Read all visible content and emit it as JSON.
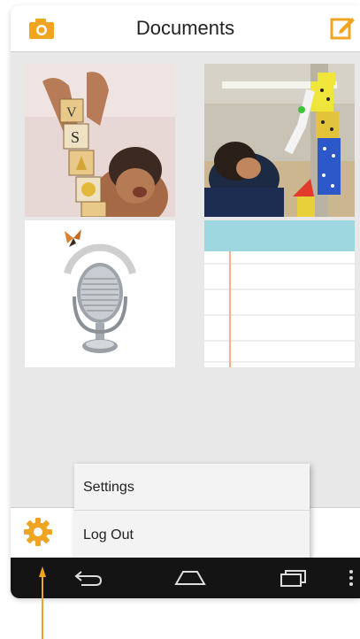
{
  "header": {
    "title": "Documents",
    "camera_icon": "camera-icon",
    "edit_icon": "compose-icon"
  },
  "documents": [
    {
      "thumb": "photo-child-blocks"
    },
    {
      "thumb": "photo-child-stacking-blocks"
    },
    {
      "thumb": "audio-microphone"
    },
    {
      "thumb": "notebook-paper"
    }
  ],
  "menu": {
    "settings_label": "Settings",
    "logout_label": "Log Out"
  },
  "bottom": {
    "gear_icon": "gear-icon"
  },
  "navbar": {
    "back_icon": "back-icon",
    "home_icon": "home-icon",
    "recents_icon": "recents-icon",
    "more_icon": "more-icon"
  },
  "colors": {
    "accent": "#f0a520",
    "navbar": "#141414",
    "notebook_header": "#9fd7e1",
    "margin_line": "#f4b08a"
  }
}
